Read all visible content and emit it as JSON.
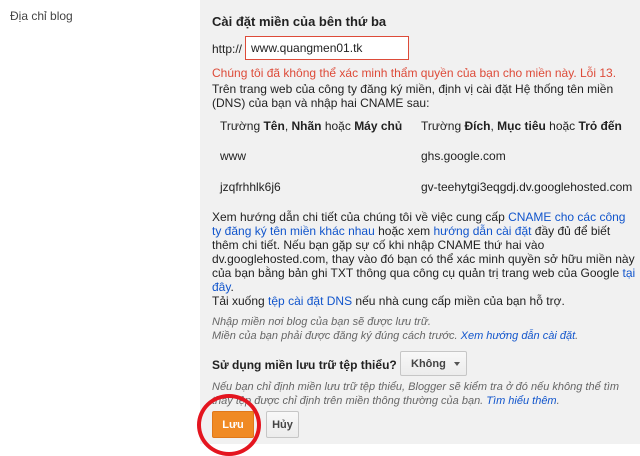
{
  "sidebar": {
    "label": "Địa chỉ blog"
  },
  "form": {
    "title": "Cài đặt miền của bên thứ ba",
    "http_prefix": "http://",
    "domain_value": "www.quangmen01.tk",
    "error": "Chúng tôi đã không thể xác minh thẩm quyền của bạn cho miền này. Lỗi 13.",
    "instructions_line1": "Trên trang web của công ty đăng ký miền, định vị cài đặt Hệ thống tên miền",
    "instructions_line2": "(DNS) của bạn và nhập hai CNAME sau:"
  },
  "cname_table": {
    "header_left": {
      "a": "Trường ",
      "b": "Tên",
      "c": ", ",
      "d": "Nhãn",
      "e": " hoặc ",
      "f": "Máy chủ"
    },
    "header_right": {
      "a": "Trường ",
      "b": "Đích",
      "c": ", ",
      "d": "Mục tiêu",
      "e": " hoặc ",
      "f": "Trỏ đến"
    },
    "rows": [
      {
        "name": "www",
        "target": "ghs.google.com"
      },
      {
        "name": "jzqfrhhlk6j6",
        "target": "gv-teehytgi3eqgdj.dv.googlehosted.com"
      }
    ]
  },
  "help": {
    "l1_a": "Xem hướng dẫn chi tiết của chúng tôi về việc cung cấp ",
    "l1_link": "CNAME cho các công",
    "l2_link": "ty đăng ký tên miền khác nhau",
    "l2_b": " hoặc xem ",
    "l2_link2": "hướng dẫn cài đặt",
    "l2_c": " đầy đủ để biết",
    "l3": "thêm chi tiết. Nếu bạn gặp sự cố khi nhập CNAME thứ hai vào",
    "l4": "dv.googlehosted.com, thay vào đó bạn có thể xác minh quyền sở hữu miền này",
    "l5_a": "của bạn bằng bản ghi TXT thông qua công cụ quản trị trang web của Google ",
    "l5_link": "tại",
    "l6_link": "đây",
    "l6_b": ".",
    "l7_a": "Tải xuống ",
    "l7_link": "tệp cài đặt DNS",
    "l7_b": " nếu nhà cung cấp miền của bạn hỗ trợ."
  },
  "note1": {
    "l1": "Nhập miền nơi blog của bạn sẽ được lưu trữ.",
    "l2_a": "Miền của bạn phải được đăng ký đúng cách trước. ",
    "l2_link": "Xem hướng dẫn cài đặt",
    "l2_b": "."
  },
  "minimal": {
    "label": "Sử dụng miền lưu trữ tệp thiểu?",
    "selected": "Không"
  },
  "note2": {
    "l1": "Nếu bạn chỉ định miền lưu trữ tệp thiểu, Blogger sẽ kiểm tra ở đó nếu không thể tìm",
    "l2_a": "thấy tệp được chỉ định trên miền thông thường của bạn. ",
    "l2_link": "Tìm hiểu thêm",
    "l2_b": "."
  },
  "actions": {
    "save": "Lưu",
    "cancel": "Hủy"
  },
  "colors": {
    "accent": "#f08a24",
    "error": "#dd4b39",
    "link": "#1155cc",
    "highlight": "#e4151f"
  }
}
